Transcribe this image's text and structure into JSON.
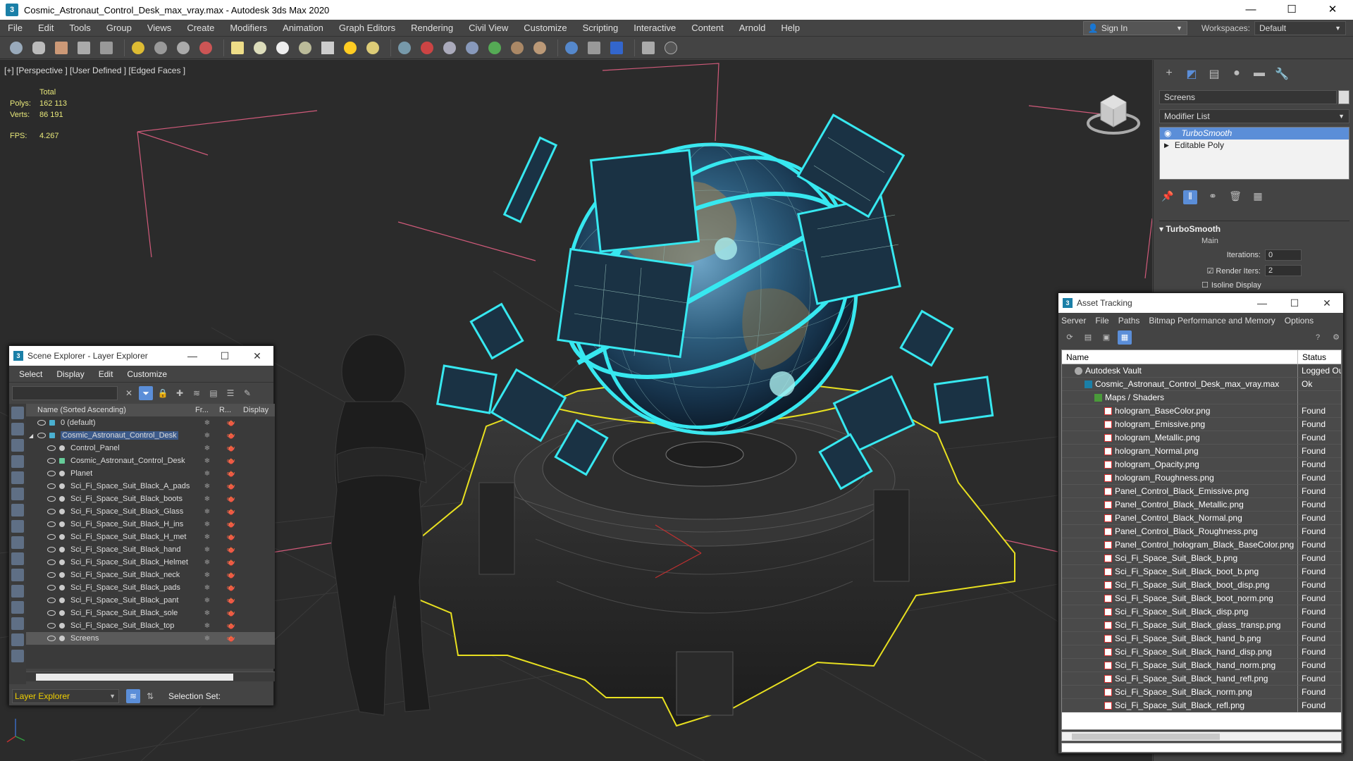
{
  "window": {
    "title": "Cosmic_Astronaut_Control_Desk_max_vray.max - Autodesk 3ds Max 2020",
    "app_icon": "3",
    "minimize": "—",
    "maximize": "☐",
    "close": "✕"
  },
  "menu": [
    "File",
    "Edit",
    "Tools",
    "Group",
    "Views",
    "Create",
    "Modifiers",
    "Animation",
    "Graph Editors",
    "Rendering",
    "Civil View",
    "Customize",
    "Scripting",
    "Interactive",
    "Content",
    "Arnold",
    "Help"
  ],
  "signin": {
    "label": "Sign In",
    "icon": "user-icon"
  },
  "workspaces": {
    "label": "Workspaces:",
    "value": "Default"
  },
  "viewport": {
    "label": "[+] [Perspective ] [User Defined ] [Edged Faces ]",
    "stats": {
      "total_label": "Total",
      "polys_label": "Polys:",
      "polys": "162 113",
      "verts_label": "Verts:",
      "verts": "86 191",
      "fps_label": "FPS:",
      "fps": "4.267"
    }
  },
  "command_panel": {
    "object_name": "Screens",
    "modifier_list": "Modifier List",
    "stack": [
      "TurboSmooth",
      "Editable Poly"
    ],
    "rollout": {
      "title": "TurboSmooth",
      "section": "Main",
      "iterations_label": "Iterations:",
      "iterations": "0",
      "render_iters_label": "Render Iters:",
      "render_iters": "2",
      "isoline_label": "Isoline Display"
    }
  },
  "scene_explorer": {
    "title": "Scene Explorer - Layer Explorer",
    "menu": [
      "Select",
      "Display",
      "Edit",
      "Customize"
    ],
    "columns": {
      "name": "Name (Sorted Ascending)",
      "frozen": "Fr...",
      "render": "R...",
      "display": "Display"
    },
    "rows": [
      {
        "name": "0 (default)",
        "level": 1,
        "type": "layer"
      },
      {
        "name": "Cosmic_Astronaut_Control_Desk",
        "level": 1,
        "type": "layer",
        "expanded": true,
        "active": true
      },
      {
        "name": "Control_Panel",
        "level": 2,
        "type": "object"
      },
      {
        "name": "Cosmic_Astronaut_Control_Desk",
        "level": 2,
        "type": "group"
      },
      {
        "name": "Planet",
        "level": 2,
        "type": "object"
      },
      {
        "name": "Sci_Fi_Space_Suit_Black_A_pads",
        "level": 2,
        "type": "object"
      },
      {
        "name": "Sci_Fi_Space_Suit_Black_boots",
        "level": 2,
        "type": "object"
      },
      {
        "name": "Sci_Fi_Space_Suit_Black_Glass",
        "level": 2,
        "type": "object"
      },
      {
        "name": "Sci_Fi_Space_Suit_Black_H_ins",
        "level": 2,
        "type": "object"
      },
      {
        "name": "Sci_Fi_Space_Suit_Black_H_met",
        "level": 2,
        "type": "object"
      },
      {
        "name": "Sci_Fi_Space_Suit_Black_hand",
        "level": 2,
        "type": "object"
      },
      {
        "name": "Sci_Fi_Space_Suit_Black_Helmet",
        "level": 2,
        "type": "object"
      },
      {
        "name": "Sci_Fi_Space_Suit_Black_neck",
        "level": 2,
        "type": "object"
      },
      {
        "name": "Sci_Fi_Space_Suit_Black_pads",
        "level": 2,
        "type": "object"
      },
      {
        "name": "Sci_Fi_Space_Suit_Black_pant",
        "level": 2,
        "type": "object"
      },
      {
        "name": "Sci_Fi_Space_Suit_Black_sole",
        "level": 2,
        "type": "object"
      },
      {
        "name": "Sci_Fi_Space_Suit_Black_top",
        "level": 2,
        "type": "object"
      },
      {
        "name": "Screens",
        "level": 2,
        "type": "object",
        "selected": true
      }
    ],
    "footer": {
      "explorer": "Layer Explorer",
      "selection_set": "Selection Set:"
    }
  },
  "asset_tracking": {
    "title": "Asset Tracking",
    "menu": [
      "Server",
      "File",
      "Paths",
      "Bitmap Performance and Memory",
      "Options"
    ],
    "columns": {
      "name": "Name",
      "status": "Status"
    },
    "rows": [
      {
        "name": "Autodesk Vault",
        "status": "Logged Ou",
        "level": 1,
        "icon": "vault"
      },
      {
        "name": "Cosmic_Astronaut_Control_Desk_max_vray.max",
        "status": "Ok",
        "level": 2,
        "icon": "max"
      },
      {
        "name": "Maps / Shaders",
        "status": "",
        "level": 3,
        "icon": "folder"
      },
      {
        "name": "hologram_BaseColor.png",
        "status": "Found",
        "level": 4,
        "icon": "png"
      },
      {
        "name": "hologram_Emissive.png",
        "status": "Found",
        "level": 4,
        "icon": "png"
      },
      {
        "name": "hologram_Metallic.png",
        "status": "Found",
        "level": 4,
        "icon": "png"
      },
      {
        "name": "hologram_Normal.png",
        "status": "Found",
        "level": 4,
        "icon": "png"
      },
      {
        "name": "hologram_Opacity.png",
        "status": "Found",
        "level": 4,
        "icon": "png"
      },
      {
        "name": "hologram_Roughness.png",
        "status": "Found",
        "level": 4,
        "icon": "png"
      },
      {
        "name": "Panel_Control_Black_Emissive.png",
        "status": "Found",
        "level": 4,
        "icon": "png"
      },
      {
        "name": "Panel_Control_Black_Metallic.png",
        "status": "Found",
        "level": 4,
        "icon": "png"
      },
      {
        "name": "Panel_Control_Black_Normal.png",
        "status": "Found",
        "level": 4,
        "icon": "png"
      },
      {
        "name": "Panel_Control_Black_Roughness.png",
        "status": "Found",
        "level": 4,
        "icon": "png"
      },
      {
        "name": "Panel_Control_hologram_Black_BaseColor.png",
        "status": "Found",
        "level": 4,
        "icon": "png"
      },
      {
        "name": "Sci_Fi_Space_Suit_Black_b.png",
        "status": "Found",
        "level": 4,
        "icon": "png"
      },
      {
        "name": "Sci_Fi_Space_Suit_Black_boot_b.png",
        "status": "Found",
        "level": 4,
        "icon": "png"
      },
      {
        "name": "Sci_Fi_Space_Suit_Black_boot_disp.png",
        "status": "Found",
        "level": 4,
        "icon": "png"
      },
      {
        "name": "Sci_Fi_Space_Suit_Black_boot_norm.png",
        "status": "Found",
        "level": 4,
        "icon": "png"
      },
      {
        "name": "Sci_Fi_Space_Suit_Black_disp.png",
        "status": "Found",
        "level": 4,
        "icon": "png"
      },
      {
        "name": "Sci_Fi_Space_Suit_Black_glass_transp.png",
        "status": "Found",
        "level": 4,
        "icon": "png"
      },
      {
        "name": "Sci_Fi_Space_Suit_Black_hand_b.png",
        "status": "Found",
        "level": 4,
        "icon": "png"
      },
      {
        "name": "Sci_Fi_Space_Suit_Black_hand_disp.png",
        "status": "Found",
        "level": 4,
        "icon": "png"
      },
      {
        "name": "Sci_Fi_Space_Suit_Black_hand_norm.png",
        "status": "Found",
        "level": 4,
        "icon": "png"
      },
      {
        "name": "Sci_Fi_Space_Suit_Black_hand_refl.png",
        "status": "Found",
        "level": 4,
        "icon": "png"
      },
      {
        "name": "Sci_Fi_Space_Suit_Black_norm.png",
        "status": "Found",
        "level": 4,
        "icon": "png"
      },
      {
        "name": "Sci_Fi_Space_Suit_Black_refl.png",
        "status": "Found",
        "level": 4,
        "icon": "png"
      }
    ]
  },
  "colors": {
    "selection_highlight": "#5b8ed8",
    "hologram_cyan": "#37e8f0",
    "selection_outline": "#f0e020",
    "stats_text": "#e8e87a"
  }
}
